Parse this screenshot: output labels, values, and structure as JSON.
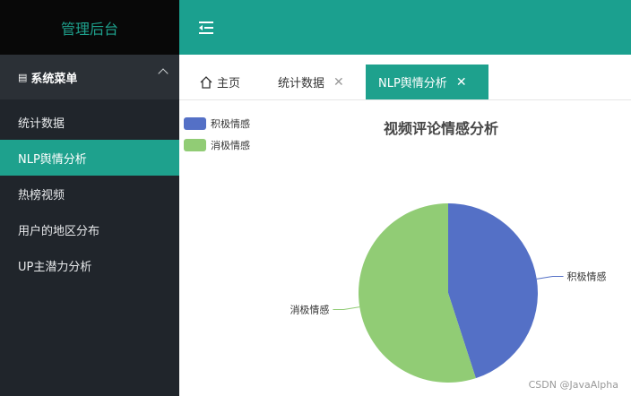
{
  "sidebar": {
    "brand": "管理后台",
    "group_label": "系统菜单",
    "items": [
      {
        "label": "统计数据",
        "active": false
      },
      {
        "label": "NLP舆情分析",
        "active": true
      },
      {
        "label": "热榜视频",
        "active": false
      },
      {
        "label": "用户的地区分布",
        "active": false
      },
      {
        "label": "UP主潜力分析",
        "active": false
      }
    ]
  },
  "tabs": [
    {
      "label": "主页",
      "icon": "home-icon",
      "closable": false
    },
    {
      "label": "统计数据",
      "closable": true
    },
    {
      "label": "NLP舆情分析",
      "closable": true,
      "active": true
    }
  ],
  "chart_data": {
    "type": "pie",
    "title": "视频评论情感分析",
    "legend_position": "top-left",
    "slices": [
      {
        "name": "积极情感",
        "value": 45,
        "color": "#5470c6"
      },
      {
        "name": "消极情感",
        "value": 55,
        "color": "#91cc75"
      }
    ]
  },
  "watermark": "CSDN @JavaAlpha",
  "colors": {
    "accent": "#1ea18d",
    "sidebar_bg": "#20252b"
  }
}
